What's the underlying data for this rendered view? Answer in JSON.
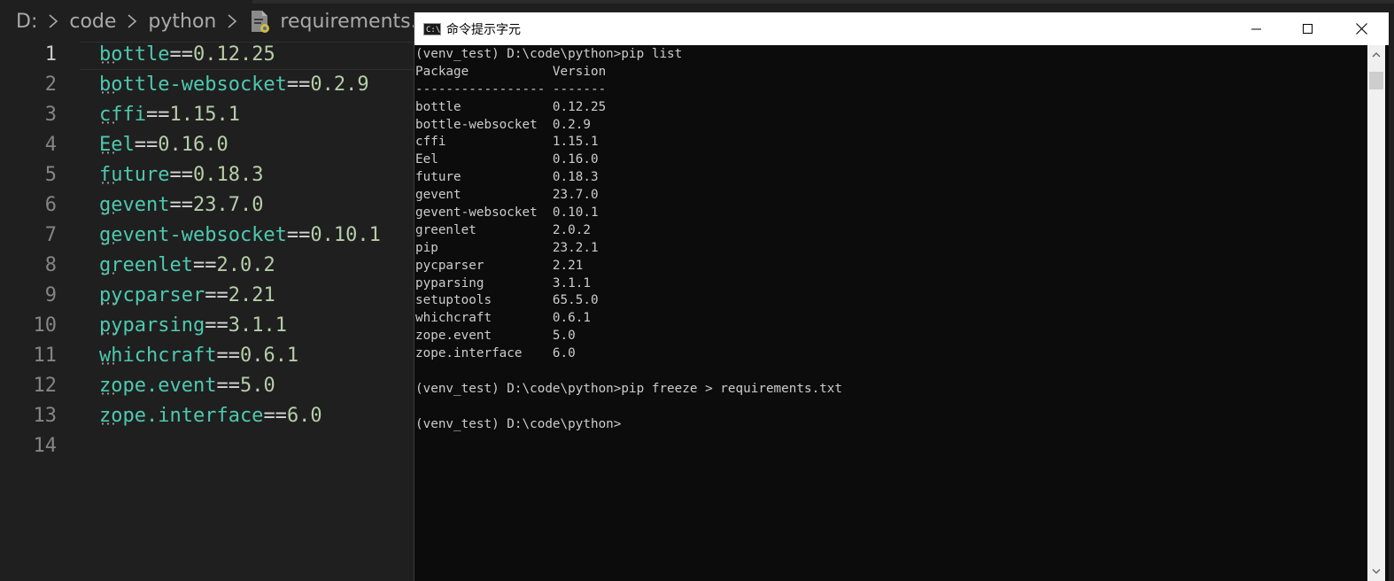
{
  "editor": {
    "breadcrumb": [
      "D:",
      "code",
      "python",
      "requirements.txt"
    ],
    "lines": [
      {
        "n": "1",
        "pkg": "bottle",
        "op": "==",
        "ver": "0.12.25"
      },
      {
        "n": "2",
        "pkg": "bottle-websocket",
        "op": "==",
        "ver": "0.2.9"
      },
      {
        "n": "3",
        "pkg": "cffi",
        "op": "==",
        "ver": "1.15.1"
      },
      {
        "n": "4",
        "pkg": "Eel",
        "op": "==",
        "ver": "0.16.0"
      },
      {
        "n": "5",
        "pkg": "future",
        "op": "==",
        "ver": "0.18.3"
      },
      {
        "n": "6",
        "pkg": "gevent",
        "op": "==",
        "ver": "23.7.0"
      },
      {
        "n": "7",
        "pkg": "gevent-websocket",
        "op": "==",
        "ver": "0.10.1"
      },
      {
        "n": "8",
        "pkg": "greenlet",
        "op": "==",
        "ver": "2.0.2"
      },
      {
        "n": "9",
        "pkg": "pycparser",
        "op": "==",
        "ver": "2.21"
      },
      {
        "n": "10",
        "pkg": "pyparsing",
        "op": "==",
        "ver": "3.1.1"
      },
      {
        "n": "11",
        "pkg": "whichcraft",
        "op": "==",
        "ver": "0.6.1"
      },
      {
        "n": "12",
        "pkg": "zope.event",
        "op": "==",
        "ver": "5.0"
      },
      {
        "n": "13",
        "pkg": "zope.interface",
        "op": "==",
        "ver": "6.0"
      },
      {
        "n": "14",
        "pkg": "",
        "op": "",
        "ver": ""
      }
    ],
    "active_line": "1"
  },
  "console": {
    "title": "命令提示字元",
    "icon_text": "C:\\",
    "lines": [
      "(venv_test) D:\\code\\python>pip list",
      "Package           Version",
      "----------------- -------",
      "bottle            0.12.25",
      "bottle-websocket  0.2.9",
      "cffi              1.15.1",
      "Eel               0.16.0",
      "future            0.18.3",
      "gevent            23.7.0",
      "gevent-websocket  0.10.1",
      "greenlet          2.0.2",
      "pip               23.2.1",
      "pycparser         2.21",
      "pyparsing         3.1.1",
      "setuptools        65.5.0",
      "whichcraft        0.6.1",
      "zope.event        5.0",
      "zope.interface    6.0",
      "",
      "(venv_test) D:\\code\\python>pip freeze > requirements.txt",
      "",
      "(venv_test) D:\\code\\python>"
    ]
  },
  "colors": {
    "package": "#4ec9b0",
    "version": "#b5cea8",
    "operator": "#d4d4d4",
    "console_bg": "#0c0c0c",
    "console_text": "#cccccc"
  }
}
